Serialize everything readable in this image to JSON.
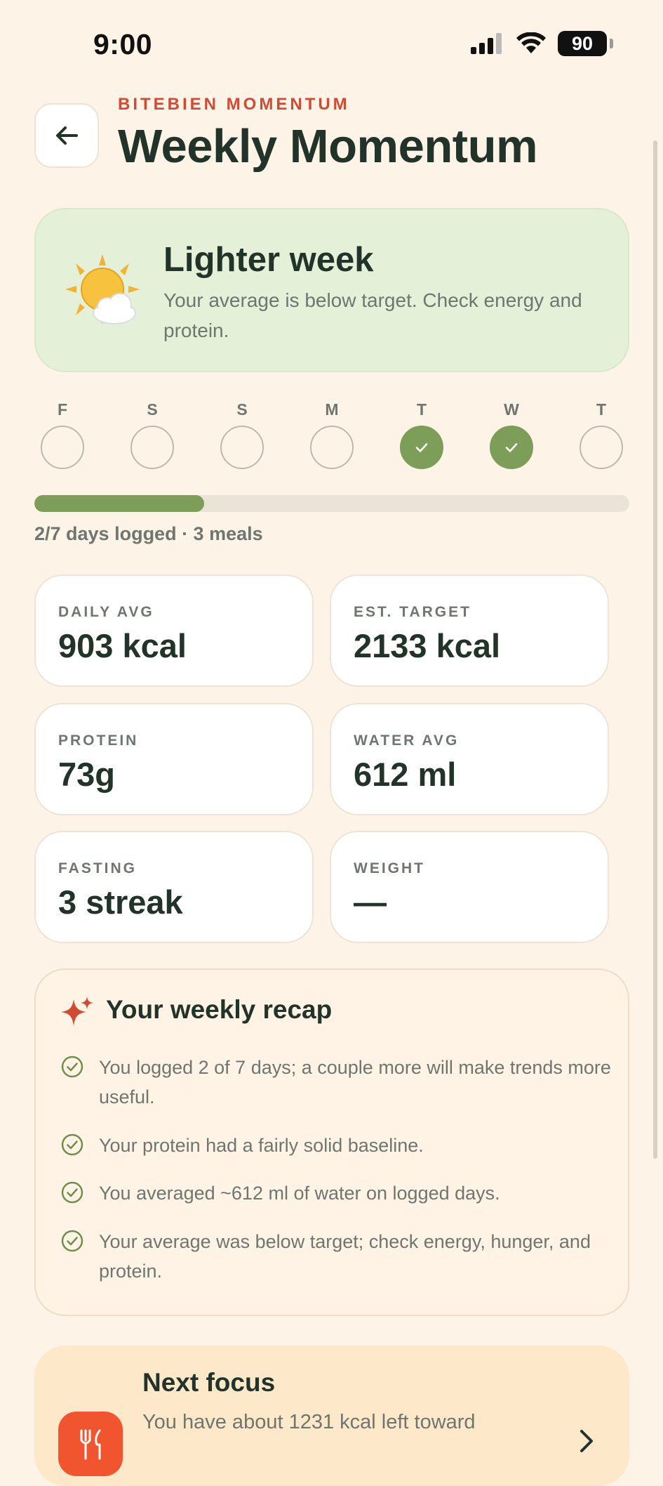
{
  "status_bar": {
    "time": "9:00",
    "battery": "90"
  },
  "header": {
    "eyebrow": "BITEBIEN MOMENTUM",
    "title": "Weekly Momentum",
    "back_icon": "arrow-left-icon"
  },
  "hero": {
    "icon": "sun-behind-cloud-icon",
    "title": "Lighter week",
    "text": "Your average is below target. Check energy and protein."
  },
  "week": {
    "days": [
      {
        "letter": "F",
        "logged": false
      },
      {
        "letter": "S",
        "logged": false
      },
      {
        "letter": "S",
        "logged": false
      },
      {
        "letter": "M",
        "logged": false
      },
      {
        "letter": "T",
        "logged": true
      },
      {
        "letter": "W",
        "logged": true
      },
      {
        "letter": "T",
        "logged": false
      }
    ],
    "progress_fraction": 0.2857,
    "caption": "2/7 days logged · 3 meals"
  },
  "stats": [
    {
      "label": "DAILY AVG",
      "value": "903 kcal"
    },
    {
      "label": "EST. TARGET",
      "value": "2133 kcal"
    },
    {
      "label": "PROTEIN",
      "value": "73g"
    },
    {
      "label": "WATER AVG",
      "value": "612 ml"
    },
    {
      "label": "FASTING",
      "value": "3 streak"
    },
    {
      "label": "WEIGHT",
      "value": "—"
    }
  ],
  "recap": {
    "icon": "sparkles-icon",
    "title": "Your weekly recap",
    "items": [
      "You logged 2 of 7 days; a couple more will make trends more useful.",
      "Your protein had a fairly solid baseline.",
      "You averaged ~612 ml of water on logged days.",
      "Your average was below target; check energy, hunger, and protein."
    ]
  },
  "focus": {
    "icon": "utensils-icon",
    "title": "Next focus",
    "text": "You have about 1231 kcal left toward"
  },
  "colors": {
    "background": "#FDF3E6",
    "accent_green": "#7D9E58",
    "accent_red": "#D14B34",
    "focus_orange": "#F0552F"
  }
}
